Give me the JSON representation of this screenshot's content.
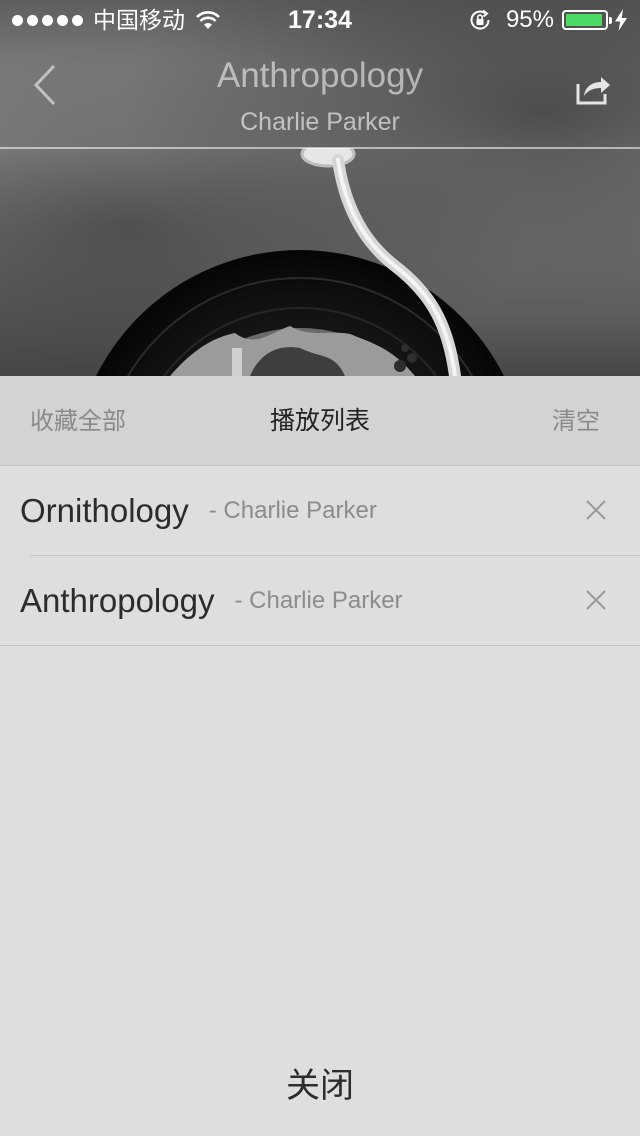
{
  "status_bar": {
    "carrier": "中国移动",
    "time": "17:34",
    "battery_percent_text": "95%",
    "battery_level": 0.95,
    "battery_color": "#4cd964",
    "icons": [
      "signal-dots",
      "wifi-icon",
      "rotation-lock-icon",
      "battery-icon",
      "charging-bolt-icon"
    ]
  },
  "now_playing": {
    "title": "Anthropology",
    "artist": "Charlie Parker",
    "back_icon": "chevron-left-icon",
    "share_icon": "share-icon"
  },
  "playlist": {
    "collect_all_label": "收藏全部",
    "title": "播放列表",
    "clear_label": "清空",
    "tracks": [
      {
        "name": "Ornithology",
        "artist": "- Charlie Parker"
      },
      {
        "name": "Anthropology",
        "artist": "- Charlie Parker"
      }
    ],
    "remove_icon": "close-icon",
    "close_label": "关闭"
  }
}
